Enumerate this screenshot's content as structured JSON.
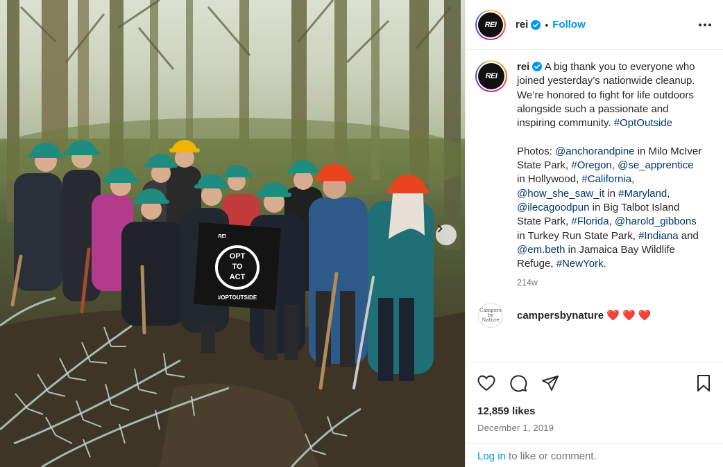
{
  "header": {
    "username": "rei",
    "separator": "•",
    "follow_label": "Follow",
    "avatar_text": "REI"
  },
  "caption": {
    "username": "rei",
    "text_1": " A big thank you to everyone who joined yesterday’s nationwide cleanup. We’re honored to fight for life outdoors alongside such a passionate and inspiring community. ",
    "hashtag_optoutside": "#OptOutside",
    "photos_label": "Photos: ",
    "m_anchorandpine": "@anchorandpine",
    "t_milo": " in Milo McIver State Park, ",
    "h_oregon": "#Oregon",
    "t_comma1": ", ",
    "m_se_apprentice": "@se_apprentice",
    "t_hollywood": " in Hollywood, ",
    "h_california": "#California",
    "t_comma2": ", ",
    "m_how_she_saw_it": "@how_she_saw_it",
    "t_in1": " in ",
    "h_maryland": "#Maryland",
    "t_comma3": ", ",
    "m_ilecagoodpun": "@ilecagoodpun",
    "t_bigtalbot": " in Big Talbot Island State Park, ",
    "h_florida": "#Florida",
    "t_comma4": ", ",
    "m_harold_gibbons": "@harold_gibbons",
    "t_turkeyrun": " in Turkey Run State Park, ",
    "h_indiana": "#Indiana",
    "t_and": " and ",
    "m_em_beth": "@em.beth",
    "t_jamaica": " in Jamaica Bay Wildlife Refuge, ",
    "h_newyork": "#NewYork",
    "t_period": ".",
    "time_ago": "214w"
  },
  "comment": {
    "username": "campersbynature",
    "text": " ❤️ ❤️ ❤️",
    "avatar_line1": "Campers",
    "avatar_line2": "by",
    "avatar_line3": "Nature"
  },
  "stats": {
    "likes": "12,859 likes",
    "date": "December 1, 2019"
  },
  "footer": {
    "login_label": "Log in",
    "rest": " to like or comment."
  },
  "photo": {
    "banner_line1": "OPT",
    "banner_line2": "TO",
    "banner_line3": "ACT",
    "banner_hashtag": "#OPTOUTSIDE",
    "banner_brand": "REI"
  },
  "colors": {
    "accent_blue": "#0095f6",
    "link_dark_blue": "#00376b",
    "heart_red": "#e0245e",
    "muted_text": "#737373",
    "helmet_green": "#1e8c7e",
    "helmet_orange": "#e8451e",
    "helmet_yellow": "#f0b400"
  }
}
